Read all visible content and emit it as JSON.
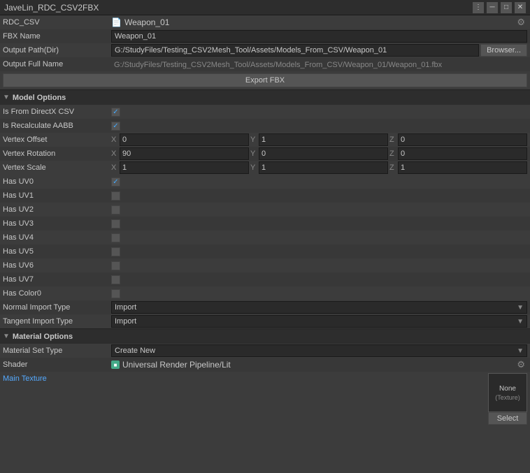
{
  "titleBar": {
    "title": "JaveLin_RDC_CSV2FBX",
    "controls": [
      "menu-dots",
      "minimize",
      "maximize",
      "close"
    ]
  },
  "rows": {
    "rdcCsv": {
      "label": "RDC_CSV",
      "value": "Weapon_01",
      "icon": "file-icon"
    },
    "fbxName": {
      "label": "FBX Name",
      "value": "Weapon_01"
    },
    "outputPath": {
      "label": "Output Path(Dir)",
      "value": "G:/StudyFiles/Testing_CSV2Mesh_Tool/Assets/Models_From_CSV/Weapon_01",
      "browserBtn": "Browser..."
    },
    "outputFullName": {
      "label": "Output Full Name",
      "value": "G:/StudyFiles/Testing_CSV2Mesh_Tool/Assets/Models_From_CSV/Weapon_01/Weapon_01.fbx"
    },
    "exportBtn": "Export FBX"
  },
  "modelOptions": {
    "sectionTitle": "Model Options",
    "isFromDirectX": {
      "label": "Is From DirectX CSV",
      "checked": true
    },
    "isRecalculateAABB": {
      "label": "Is Recalculate AABB",
      "checked": true
    },
    "vertexOffset": {
      "label": "Vertex Offset",
      "x": "0",
      "y": "1",
      "z": "0"
    },
    "vertexRotation": {
      "label": "Vertex Rotation",
      "x": "90",
      "y": "0",
      "z": "0"
    },
    "vertexScale": {
      "label": "Vertex Scale",
      "x": "1",
      "y": "1",
      "z": "1"
    },
    "uvChannels": [
      {
        "label": "Has UV0",
        "checked": true
      },
      {
        "label": "Has UV1",
        "checked": false
      },
      {
        "label": "Has UV2",
        "checked": false
      },
      {
        "label": "Has UV3",
        "checked": false
      },
      {
        "label": "Has UV4",
        "checked": false
      },
      {
        "label": "Has UV5",
        "checked": false
      },
      {
        "label": "Has UV6",
        "checked": false
      },
      {
        "label": "Has UV7",
        "checked": false
      }
    ],
    "hasColor0": {
      "label": "Has Color0",
      "checked": false
    },
    "normalImportType": {
      "label": "Normal Import Type",
      "value": "Import"
    },
    "tangentImportType": {
      "label": "Tangent Import Type",
      "value": "Import"
    }
  },
  "materialOptions": {
    "sectionTitle": "Material Options",
    "materialSetType": {
      "label": "Material Set Type",
      "value": "Create New"
    },
    "shader": {
      "label": "Shader",
      "value": "Universal Render Pipeline/Lit",
      "iconColor": "#4a8844"
    },
    "mainTexture": {
      "label": "Main Texture",
      "noneText": "None",
      "typeText": "(Texture)",
      "selectBtn": "Select"
    }
  },
  "icons": {
    "file": "📄",
    "chevronDown": "▼",
    "settings": "⋮",
    "windowMenu": "⋮",
    "minimize": "─",
    "maximize": "□",
    "close": "✕",
    "checkmark": "✓",
    "gear": "⚙",
    "shaderIcon": "■"
  }
}
